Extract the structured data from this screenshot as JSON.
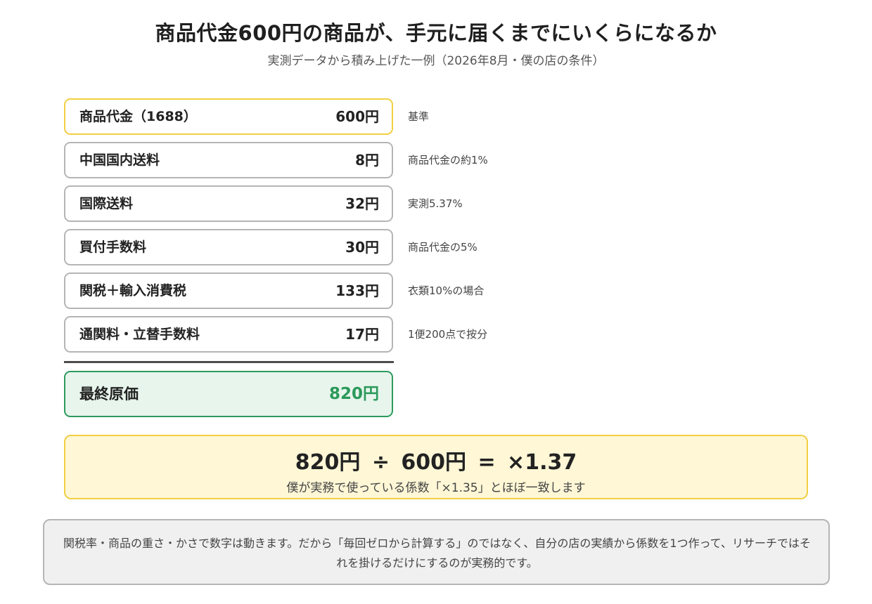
{
  "header": {
    "title": "商品代金600円の商品が、手元に届くまでにいくらになるか",
    "subtitle": "実測データから積み上げた一例（2026年8月・僕の店の条件）"
  },
  "rows": [
    {
      "label": "商品代金（1688）",
      "value": "600円",
      "note": "基準"
    },
    {
      "label": "中国国内送料",
      "value": "8円",
      "note": "商品代金の約1%"
    },
    {
      "label": "国際送料",
      "value": "32円",
      "note": "実測5.37%"
    },
    {
      "label": "買付手数料",
      "value": "30円",
      "note": "商品代金の5%"
    },
    {
      "label": "関税＋輸入消費税",
      "value": "133円",
      "note": "衣類10%の場合"
    },
    {
      "label": "通関料・立替手数料",
      "value": "17円",
      "note": "1便200点で按分"
    }
  ],
  "total": {
    "label": "最終原価",
    "value": "820円"
  },
  "formula": {
    "text": "820円 ÷ 600円 = ×1.37",
    "note": "僕が実務で使っている係数「×1.35」とほぼ一致します"
  },
  "footer": {
    "note": "関税率・商品の重さ・かさで数字は動きます。だから「毎回ゼロから計算する」のではなく、自分の店の実績から係数を1つ作って、リサーチではそれを掛けるだけにするのが実務的です。"
  },
  "colors": {
    "base_border": "#f2cf42",
    "row_border": "#b5b5b5",
    "total_border": "#2e9a5d",
    "total_fill": "#e7f5ec",
    "total_value": "#2a9a5a",
    "formula_fill": "#fff7d6"
  }
}
